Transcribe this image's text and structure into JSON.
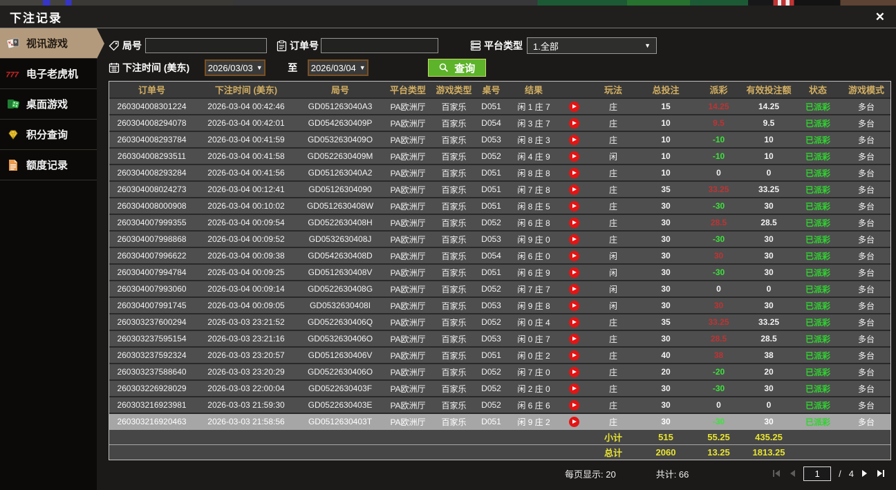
{
  "dialog": {
    "title": "下注记录",
    "close_glyph": "✕"
  },
  "glyphs": {
    "dropdown": "▼"
  },
  "colors": {
    "accent_tab": "#b49a7c",
    "search_green": "#5db32a",
    "header_gold": "#d2ae62",
    "payout_win": "#c03333",
    "payout_loss": "#3ce23c",
    "status_paid": "#2fd42f",
    "summary_yellow": "#e8e431",
    "date_border": "#7a4f22"
  },
  "sidebar": {
    "items": [
      {
        "label": "视讯游戏",
        "icon": "playing-cards-icon",
        "active": true
      },
      {
        "label": "电子老虎机",
        "icon": "slot-777-icon",
        "active": false
      },
      {
        "label": "桌面游戏",
        "icon": "dice-icon",
        "active": false
      },
      {
        "label": "积分查询",
        "icon": "diamond-icon",
        "active": false
      },
      {
        "label": "额度记录",
        "icon": "document-icon",
        "active": false
      }
    ]
  },
  "filters": {
    "round_label": "局号",
    "round_value": "",
    "order_label": "订单号",
    "order_value": "",
    "platform_label": "平台类型",
    "platform_value": "1.全部",
    "time_label": "下注时间 (美东)",
    "date_from": "2026/03/03",
    "to_label": "至",
    "date_to": "2026/03/04",
    "search_label": "查询"
  },
  "table": {
    "headers": [
      "订单号",
      "下注时间 (美东)",
      "局号",
      "平台类型",
      "游戏类型",
      "桌号",
      "结果",
      "玩法",
      "总投注",
      "派彩",
      "有效投注额",
      "状态",
      "游戏模式"
    ],
    "rows": [
      {
        "order": "260304008301224",
        "time": "2026-03-04 00:42:46",
        "round": "GD051263040A3",
        "platform": "PA欧洲厅",
        "game": "百家乐",
        "table_no": "D051",
        "result": "闲 1 庄 7",
        "bet_type": "庄",
        "bet": "15",
        "payout": "14.25",
        "payout_class": "pos",
        "valid": "14.25",
        "status": "已派彩",
        "mode": "多台",
        "selected": false
      },
      {
        "order": "260304008294078",
        "time": "2026-03-04 00:42:01",
        "round": "GD0542630409P",
        "platform": "PA欧洲厅",
        "game": "百家乐",
        "table_no": "D054",
        "result": "闲 3 庄 7",
        "bet_type": "庄",
        "bet": "10",
        "payout": "9.5",
        "payout_class": "pos",
        "valid": "9.5",
        "status": "已派彩",
        "mode": "多台",
        "selected": false
      },
      {
        "order": "260304008293784",
        "time": "2026-03-04 00:41:59",
        "round": "GD0532630409O",
        "platform": "PA欧洲厅",
        "game": "百家乐",
        "table_no": "D053",
        "result": "闲 8 庄 3",
        "bet_type": "庄",
        "bet": "10",
        "payout": "-10",
        "payout_class": "neg",
        "valid": "10",
        "status": "已派彩",
        "mode": "多台",
        "selected": false
      },
      {
        "order": "260304008293511",
        "time": "2026-03-04 00:41:58",
        "round": "GD0522630409M",
        "platform": "PA欧洲厅",
        "game": "百家乐",
        "table_no": "D052",
        "result": "闲 4 庄 9",
        "bet_type": "闲",
        "bet": "10",
        "payout": "-10",
        "payout_class": "neg",
        "valid": "10",
        "status": "已派彩",
        "mode": "多台",
        "selected": false
      },
      {
        "order": "260304008293284",
        "time": "2026-03-04 00:41:56",
        "round": "GD051263040A2",
        "platform": "PA欧洲厅",
        "game": "百家乐",
        "table_no": "D051",
        "result": "闲 8 庄 8",
        "bet_type": "庄",
        "bet": "10",
        "payout": "0",
        "payout_class": "zero",
        "valid": "0",
        "status": "已派彩",
        "mode": "多台",
        "selected": false
      },
      {
        "order": "260304008024273",
        "time": "2026-03-04 00:12:41",
        "round": "GD05126304090",
        "platform": "PA欧洲厅",
        "game": "百家乐",
        "table_no": "D051",
        "result": "闲 7 庄 8",
        "bet_type": "庄",
        "bet": "35",
        "payout": "33.25",
        "payout_class": "pos",
        "valid": "33.25",
        "status": "已派彩",
        "mode": "多台",
        "selected": false
      },
      {
        "order": "260304008000908",
        "time": "2026-03-04 00:10:02",
        "round": "GD0512630408W",
        "platform": "PA欧洲厅",
        "game": "百家乐",
        "table_no": "D051",
        "result": "闲 8 庄 5",
        "bet_type": "庄",
        "bet": "30",
        "payout": "-30",
        "payout_class": "neg",
        "valid": "30",
        "status": "已派彩",
        "mode": "多台",
        "selected": false
      },
      {
        "order": "260304007999355",
        "time": "2026-03-04 00:09:54",
        "round": "GD0522630408H",
        "platform": "PA欧洲厅",
        "game": "百家乐",
        "table_no": "D052",
        "result": "闲 6 庄 8",
        "bet_type": "庄",
        "bet": "30",
        "payout": "28.5",
        "payout_class": "pos",
        "valid": "28.5",
        "status": "已派彩",
        "mode": "多台",
        "selected": false
      },
      {
        "order": "260304007998868",
        "time": "2026-03-04 00:09:52",
        "round": "GD0532630408J",
        "platform": "PA欧洲厅",
        "game": "百家乐",
        "table_no": "D053",
        "result": "闲 9 庄 0",
        "bet_type": "庄",
        "bet": "30",
        "payout": "-30",
        "payout_class": "neg",
        "valid": "30",
        "status": "已派彩",
        "mode": "多台",
        "selected": false
      },
      {
        "order": "260304007996622",
        "time": "2026-03-04 00:09:38",
        "round": "GD0542630408D",
        "platform": "PA欧洲厅",
        "game": "百家乐",
        "table_no": "D054",
        "result": "闲 6 庄 0",
        "bet_type": "闲",
        "bet": "30",
        "payout": "30",
        "payout_class": "pos",
        "valid": "30",
        "status": "已派彩",
        "mode": "多台",
        "selected": false
      },
      {
        "order": "260304007994784",
        "time": "2026-03-04 00:09:25",
        "round": "GD0512630408V",
        "platform": "PA欧洲厅",
        "game": "百家乐",
        "table_no": "D051",
        "result": "闲 6 庄 9",
        "bet_type": "闲",
        "bet": "30",
        "payout": "-30",
        "payout_class": "neg",
        "valid": "30",
        "status": "已派彩",
        "mode": "多台",
        "selected": false
      },
      {
        "order": "260304007993060",
        "time": "2026-03-04 00:09:14",
        "round": "GD0522630408G",
        "platform": "PA欧洲厅",
        "game": "百家乐",
        "table_no": "D052",
        "result": "闲 7 庄 7",
        "bet_type": "闲",
        "bet": "30",
        "payout": "0",
        "payout_class": "zero",
        "valid": "0",
        "status": "已派彩",
        "mode": "多台",
        "selected": false
      },
      {
        "order": "260304007991745",
        "time": "2026-03-04 00:09:05",
        "round": "GD0532630408I",
        "platform": "PA欧洲厅",
        "game": "百家乐",
        "table_no": "D053",
        "result": "闲 9 庄 8",
        "bet_type": "闲",
        "bet": "30",
        "payout": "30",
        "payout_class": "pos",
        "valid": "30",
        "status": "已派彩",
        "mode": "多台",
        "selected": false
      },
      {
        "order": "260303237600294",
        "time": "2026-03-03 23:21:52",
        "round": "GD0522630406Q",
        "platform": "PA欧洲厅",
        "game": "百家乐",
        "table_no": "D052",
        "result": "闲 0 庄 4",
        "bet_type": "庄",
        "bet": "35",
        "payout": "33.25",
        "payout_class": "pos",
        "valid": "33.25",
        "status": "已派彩",
        "mode": "多台",
        "selected": false
      },
      {
        "order": "260303237595154",
        "time": "2026-03-03 23:21:16",
        "round": "GD0532630406O",
        "platform": "PA欧洲厅",
        "game": "百家乐",
        "table_no": "D053",
        "result": "闲 0 庄 7",
        "bet_type": "庄",
        "bet": "30",
        "payout": "28.5",
        "payout_class": "pos",
        "valid": "28.5",
        "status": "已派彩",
        "mode": "多台",
        "selected": false
      },
      {
        "order": "260303237592324",
        "time": "2026-03-03 23:20:57",
        "round": "GD0512630406V",
        "platform": "PA欧洲厅",
        "game": "百家乐",
        "table_no": "D051",
        "result": "闲 0 庄 2",
        "bet_type": "庄",
        "bet": "40",
        "payout": "38",
        "payout_class": "pos",
        "valid": "38",
        "status": "已派彩",
        "mode": "多台",
        "selected": false
      },
      {
        "order": "260303237588640",
        "time": "2026-03-03 23:20:29",
        "round": "GD0522630406O",
        "platform": "PA欧洲厅",
        "game": "百家乐",
        "table_no": "D052",
        "result": "闲 7 庄 0",
        "bet_type": "庄",
        "bet": "20",
        "payout": "-20",
        "payout_class": "neg",
        "valid": "20",
        "status": "已派彩",
        "mode": "多台",
        "selected": false
      },
      {
        "order": "260303226928029",
        "time": "2026-03-03 22:00:04",
        "round": "GD0522630403F",
        "platform": "PA欧洲厅",
        "game": "百家乐",
        "table_no": "D052",
        "result": "闲 2 庄 0",
        "bet_type": "庄",
        "bet": "30",
        "payout": "-30",
        "payout_class": "neg",
        "valid": "30",
        "status": "已派彩",
        "mode": "多台",
        "selected": false
      },
      {
        "order": "260303216923981",
        "time": "2026-03-03 21:59:30",
        "round": "GD0522630403E",
        "platform": "PA欧洲厅",
        "game": "百家乐",
        "table_no": "D052",
        "result": "闲 6 庄 6",
        "bet_type": "庄",
        "bet": "30",
        "payout": "0",
        "payout_class": "zero",
        "valid": "0",
        "status": "已派彩",
        "mode": "多台",
        "selected": false
      },
      {
        "order": "260303216920463",
        "time": "2026-03-03 21:58:56",
        "round": "GD0512630403T",
        "platform": "PA欧洲厅",
        "game": "百家乐",
        "table_no": "D051",
        "result": "闲 9 庄 2",
        "bet_type": "庄",
        "bet": "30",
        "payout": "-30",
        "payout_class": "neg",
        "valid": "30",
        "status": "已派彩",
        "mode": "多台",
        "selected": true
      }
    ],
    "subtotal": {
      "label": "小计",
      "bet": "515",
      "payout": "55.25",
      "valid": "435.25"
    },
    "grand_total": {
      "label": "总计",
      "bet": "2060",
      "payout": "13.25",
      "valid": "1813.25"
    }
  },
  "footer": {
    "per_page": "每页显示: 20",
    "total_count": "共计: 66",
    "page_value": "1",
    "page_sep": "/",
    "page_total": "4"
  }
}
